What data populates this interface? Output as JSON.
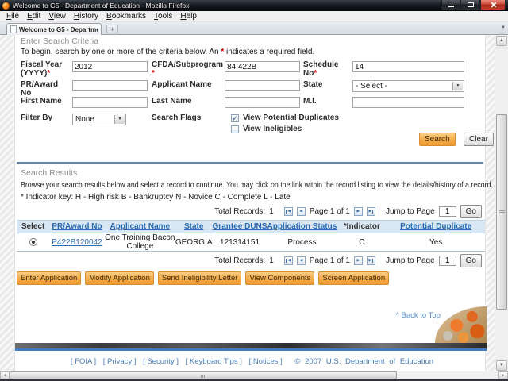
{
  "window": {
    "title": "Welcome to G5 - Department of Education - Mozilla Firefox",
    "menu_items": [
      "File",
      "Edit",
      "View",
      "History",
      "Bookmarks",
      "Tools",
      "Help"
    ],
    "tab_title": "Welcome to G5 - Department of Edu...",
    "new_tab_button": "+"
  },
  "icons": {
    "prev": "◀",
    "next": "▶",
    "up": "▲",
    "down": "▼",
    "left": "◄",
    "right": "►",
    "check": "✓",
    "list_all_tabs": "▼"
  },
  "search_criteria": {
    "heading": "Enter Search Criteria",
    "intro_prefix": "To begin, search by one or more of the criteria below. An ",
    "required_star": "*",
    "intro_suffix": " indicates a required field.",
    "fiscal_year_label": "Fiscal Year (YYYY)",
    "fiscal_year_value": "2012",
    "cfda_label": "CFDA/Subprogram ",
    "cfda_value": "84.422B",
    "schedule_label": "Schedule No",
    "schedule_value": "14",
    "pr_award_label": "PR/Award No",
    "pr_award_value": "",
    "applicant_label": "Applicant Name",
    "applicant_value": "",
    "state_label": "State",
    "state_value": "- Select -",
    "first_name_label": "First Name",
    "first_name_value": "",
    "last_name_label": "Last Name",
    "last_name_value": "",
    "mi_label": "M.I.",
    "mi_value": "",
    "filter_by_label": "Filter By",
    "filter_by_value": "None",
    "search_flags_label": "Search Flags",
    "flag1_label": "View Potential Duplicates",
    "flag1_checked": true,
    "flag2_label": "View Ineligibles",
    "flag2_checked": false,
    "search_button": "Search",
    "clear_button": "Clear"
  },
  "search_results": {
    "heading": "Search Results",
    "description": "Browse your search results below and select a record to continue. You may click on the link within the record listing to view the details/history of a record.",
    "indicator_key": "* Indicator key: H - High risk B - Bankruptcy N - Novice C - Complete L - Late",
    "pagination": {
      "total_label": "Total Records:",
      "total_value": "1",
      "page_label": "Page 1 of 1",
      "jump_label": "Jump to Page",
      "jump_value": "1",
      "go_button": "Go"
    },
    "table": {
      "headers": [
        "Select",
        "PR/Award No",
        "Applicant Name",
        "State",
        "Grantee DUNS",
        "Application Status",
        "*Indicator",
        "Potential Duplicate"
      ],
      "row": {
        "pr_award_no": "P422B120042",
        "applicant_name": "One Training Bacon College",
        "state": "GEORGIA",
        "grantee_duns": "121314151",
        "application_status": "Process",
        "indicator": "C",
        "potential_duplicate": "Yes"
      }
    },
    "action_buttons": [
      "Enter Application",
      "Modify Application",
      "Send Ineligibility Letter",
      "View Components",
      "Screen Application"
    ]
  },
  "footer": {
    "back_to_top": "^ Back to Top",
    "links": [
      "[ FOIA ]",
      "[ Privacy ]",
      "[ Security ]",
      "[ Keyboard Tips ]",
      "[ Notices ]"
    ],
    "copyright": "©  2007  U.S.  Department  of  Education"
  },
  "colors": {
    "accent_orange": "#F0A342",
    "link_blue": "#2A6CB0",
    "table_header_bg": "#D9E7F4",
    "divider_blue": "#5F86AD",
    "footer_bar_blue": "#3E7BBF",
    "footer_link_blue": "#4A7CB8",
    "required_red": "#CC0000",
    "close_button_red": "#CF4837"
  }
}
